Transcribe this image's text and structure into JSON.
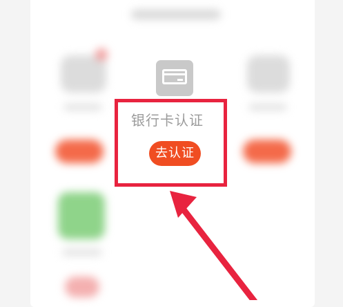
{
  "card": {
    "label": "银行卡认证",
    "button_label": "去认证"
  },
  "colors": {
    "annotation": "#e8233f",
    "button": "#f04d22",
    "label": "#9b9b9b",
    "icon": "#c9c9c9"
  },
  "icons": {
    "bank_card": "bank-card-icon",
    "arrow": "arrow-annotation"
  }
}
